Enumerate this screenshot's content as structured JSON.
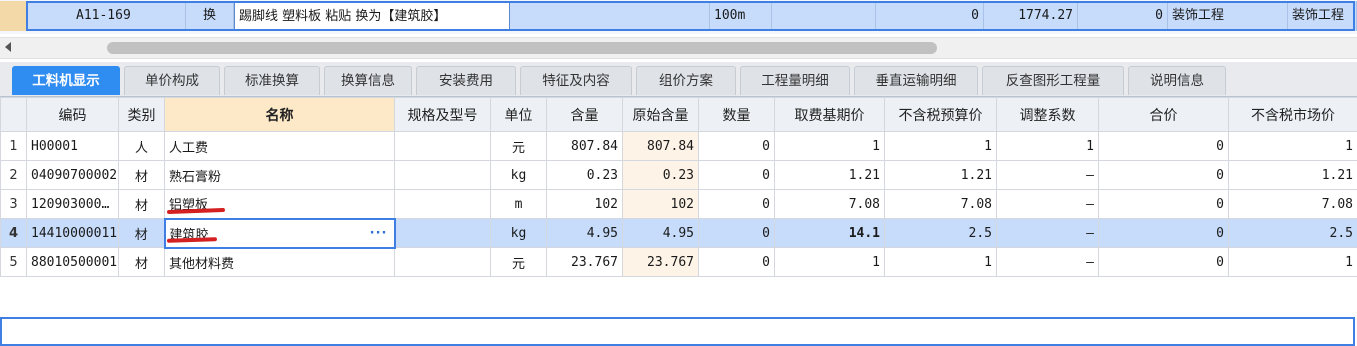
{
  "top_row": {
    "code": "A11-169",
    "type": "换",
    "name": "踢脚线 塑料板 粘贴  换为【建筑胶】",
    "unit": "100m",
    "quantity": "0",
    "price": "1774.27",
    "total": "0",
    "category": "装饰工程",
    "category2": "装饰工程"
  },
  "tabs": [
    {
      "label": "工料机显示",
      "active": true
    },
    {
      "label": "单价构成",
      "active": false
    },
    {
      "label": "标准换算",
      "active": false
    },
    {
      "label": "换算信息",
      "active": false
    },
    {
      "label": "安装费用",
      "active": false
    },
    {
      "label": "特征及内容",
      "active": false
    },
    {
      "label": "组价方案",
      "active": false
    },
    {
      "label": "工程量明细",
      "active": false
    },
    {
      "label": "垂直运输明细",
      "active": false
    },
    {
      "label": "反查图形工程量",
      "active": false
    },
    {
      "label": "说明信息",
      "active": false
    }
  ],
  "grid": {
    "columns": [
      "编码",
      "类别",
      "名称",
      "规格及型号",
      "单位",
      "含量",
      "原始含量",
      "数量",
      "取费基期价",
      "不含税预算价",
      "调整系数",
      "合价",
      "不含税市场价"
    ],
    "rows": [
      {
        "no": "1",
        "code": "H00001",
        "type": "人",
        "name": "人工费",
        "spec": "",
        "unit": "元",
        "content": "807.84",
        "orig": "807.84",
        "qty": "0",
        "base_price": "1",
        "budget_price": "1",
        "adjust": "1",
        "total": "0",
        "market_price": "1"
      },
      {
        "no": "2",
        "code": "04090700002",
        "type": "材",
        "name": "熟石膏粉",
        "spec": "",
        "unit": "kg",
        "content": "0.23",
        "orig": "0.23",
        "qty": "0",
        "base_price": "1.21",
        "budget_price": "1.21",
        "adjust": "–",
        "total": "0",
        "market_price": "1.21"
      },
      {
        "no": "3",
        "code": "120903000…",
        "type": "材",
        "name": "铝塑板",
        "spec": "",
        "unit": "m",
        "content": "102",
        "orig": "102",
        "qty": "0",
        "base_price": "7.08",
        "budget_price": "7.08",
        "adjust": "–",
        "total": "0",
        "market_price": "7.08"
      },
      {
        "no": "4",
        "code": "14410000011",
        "type": "材",
        "name": "建筑胶",
        "spec": "",
        "unit": "kg",
        "content": "4.95",
        "orig": "4.95",
        "qty": "0",
        "base_price": "14.1",
        "budget_price": "2.5",
        "adjust": "–",
        "total": "0",
        "market_price": "2.5"
      },
      {
        "no": "5",
        "code": "88010500001",
        "type": "材",
        "name": "其他材料费",
        "spec": "",
        "unit": "元",
        "content": "23.767",
        "orig": "23.767",
        "qty": "0",
        "base_price": "1",
        "budget_price": "1",
        "adjust": "–",
        "total": "0",
        "market_price": "1"
      }
    ],
    "name_cell_button": "···"
  },
  "colors": {
    "accent": "#2f8cf0",
    "selection": "#c7dcfb",
    "annotation_red": "#d42020"
  }
}
